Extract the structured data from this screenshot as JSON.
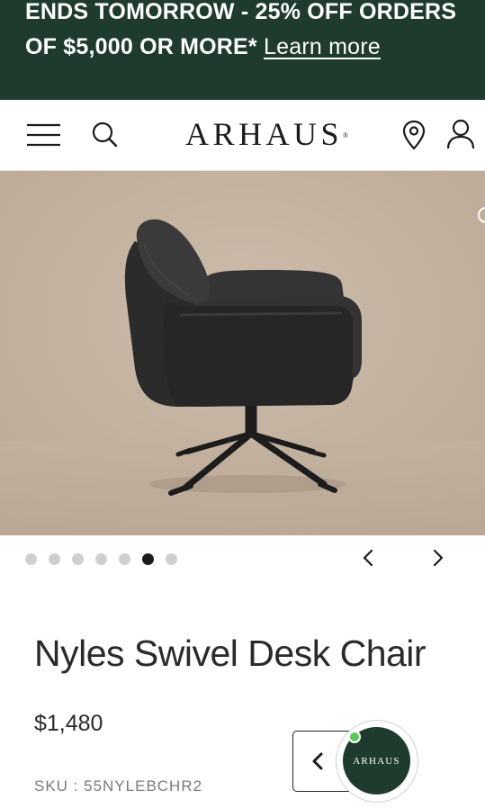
{
  "promo": {
    "text": "ENDS TOMORROW - 25% OFF ORDERS OF $5,000 OR MORE*",
    "link": "Learn more"
  },
  "header": {
    "brand": "ARHAUS",
    "trademark": "®",
    "icons": [
      "menu-icon",
      "search-icon",
      "location-pin-icon",
      "account-icon"
    ]
  },
  "carousel": {
    "slide_count": 7,
    "active_index": 5,
    "prev_icon": "chevron-left-icon",
    "next_icon": "chevron-right-icon"
  },
  "product": {
    "name": "Nyles Swivel Desk Chair",
    "price": "$1,480",
    "sku": "SKU : 55NYLEBCHR2"
  },
  "chat": {
    "brand": "ARHAUS",
    "status": "online"
  },
  "colors": {
    "brand_green": "#1e3b2d",
    "text": "#2a2a2a",
    "muted": "#7a7a7a",
    "online": "#5ac85a",
    "photo_background": "#c9b8a7"
  }
}
